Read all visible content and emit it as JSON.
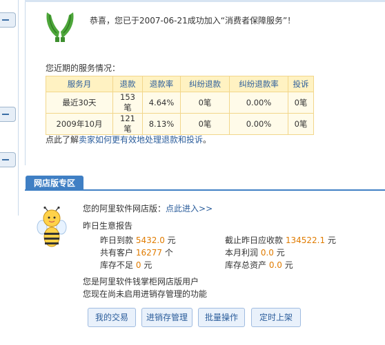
{
  "congrats": "恭喜，您已于2007-06-21成功加入“消费者保障服务”！",
  "service_title": "您近期的服务情况：",
  "table": {
    "headers": [
      "服务月",
      "退款",
      "退款率",
      "纠纷退款",
      "纠纷退款率",
      "投诉"
    ],
    "rows": [
      [
        "最近30天",
        "153笔",
        "4.64%",
        "0笔",
        "0.00%",
        "0笔"
      ],
      [
        "2009年10月",
        "121笔",
        "8.13%",
        "0笔",
        "0.00%",
        "0笔"
      ]
    ]
  },
  "hint": {
    "prefix": "点此了解",
    "link": "卖家如何更有效地处理退款和投诉",
    "suffix": "。"
  },
  "tab_label": "网店版专区",
  "shop": {
    "label": "您的阿里软件网店版：",
    "enter_link": "点此进入>>",
    "report_title": "昨日生意报告",
    "yesterday_income_label": "昨日到款",
    "yesterday_income_value": "5432.0",
    "yesterday_income_unit": "元",
    "receivable_label": "截止昨日应收款",
    "receivable_value": "134522.1",
    "receivable_unit": "元",
    "customers_label": "共有客户",
    "customers_value": "16277",
    "customers_unit": "个",
    "profit_label": "本月利润",
    "profit_value": "0.0",
    "profit_unit": "元",
    "stock_short_label": "库存不足",
    "stock_short_value": "0",
    "stock_short_unit": "元",
    "stock_assets_label": "库存总资产",
    "stock_assets_value": "0.0",
    "stock_assets_unit": "元",
    "user_note": "您是阿里软件钱掌柜网店版用户",
    "inventory_note": "您现在尚未启用进销存管理的功能"
  },
  "buttons": [
    "我的交易",
    "进销存管理",
    "批量操作",
    "定时上架"
  ]
}
